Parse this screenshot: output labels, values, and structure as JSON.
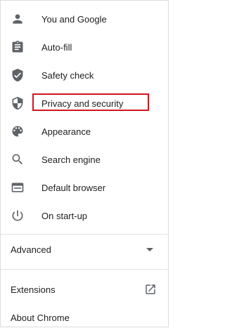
{
  "menu": {
    "items": [
      {
        "label": "You and Google",
        "icon": "person-icon"
      },
      {
        "label": "Auto-fill",
        "icon": "clipboard-icon"
      },
      {
        "label": "Safety check",
        "icon": "shield-check-icon"
      },
      {
        "label": "Privacy and security",
        "icon": "shield-half-icon"
      },
      {
        "label": "Appearance",
        "icon": "palette-icon"
      },
      {
        "label": "Search engine",
        "icon": "search-icon"
      },
      {
        "label": "Default browser",
        "icon": "browser-window-icon"
      },
      {
        "label": "On start-up",
        "icon": "power-icon"
      }
    ],
    "advanced": {
      "label": "Advanced",
      "icon": "caret-down-icon"
    },
    "extensions": {
      "label": "Extensions",
      "icon": "open-in-new-icon"
    },
    "about": {
      "label": "About Chrome"
    }
  },
  "colors": {
    "highlight_border": "#d0161f",
    "icon": "#5f6368",
    "text": "#202124"
  }
}
